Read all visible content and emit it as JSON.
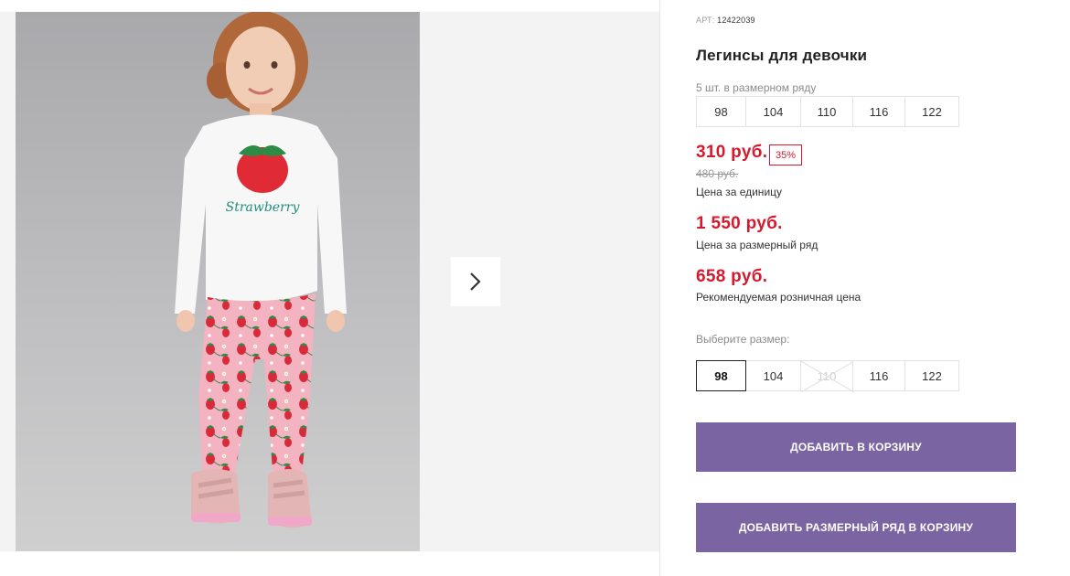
{
  "product": {
    "art_label": "АРТ:",
    "art_number": "12422039",
    "title": "Легинсы для девочки",
    "pack_note": "5 шт. в размерном ряду",
    "pack_sizes": [
      "98",
      "104",
      "110",
      "116",
      "122"
    ],
    "price": "310 руб.",
    "discount": "35%",
    "old_price": "480 руб.",
    "price_caption": "Цена за единицу",
    "pack_price": "1 550 руб.",
    "pack_price_caption": "Цена за размерный ряд",
    "rrp_price": "658 руб.",
    "rrp_caption": "Рекомендуемая розничная цена",
    "choose_size_label": "Выберите размер:",
    "sizes": [
      {
        "label": "98",
        "state": "selected"
      },
      {
        "label": "104",
        "state": "available"
      },
      {
        "label": "110",
        "state": "unavailable"
      },
      {
        "label": "116",
        "state": "available"
      },
      {
        "label": "122",
        "state": "available"
      }
    ],
    "add_to_cart": "Добавить в корзину",
    "add_pack_to_cart": "Добавить размерный ряд в корзину"
  },
  "gallery": {
    "next_icon": "chevron-right-icon",
    "shirt_print_text": "Strawberry"
  },
  "colors": {
    "accent_price": "#d7192d",
    "button": "#7b64a2"
  }
}
